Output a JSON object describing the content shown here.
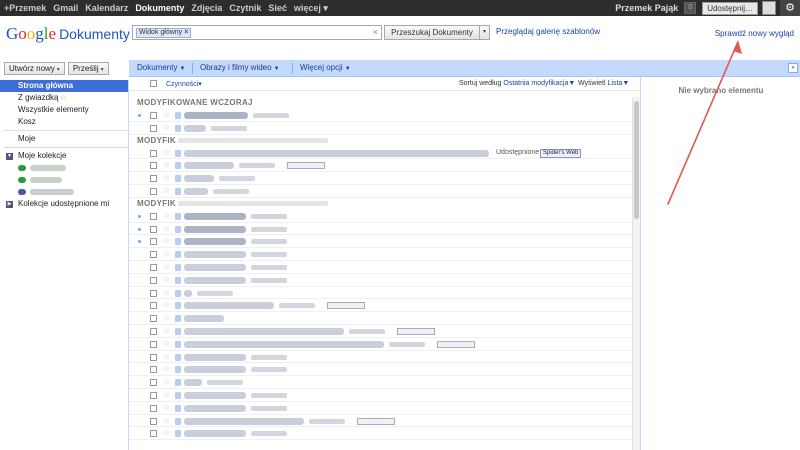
{
  "topbar": {
    "nav": [
      "+Przemek",
      "Gmail",
      "Kalendarz",
      "Dokumenty",
      "Zdjęcia",
      "Czytnik",
      "Sieć",
      "więcej ▾"
    ],
    "active_index": 3,
    "user_name": "Przemek Pająk",
    "notif_count": "0",
    "share_label": "Udostępnij…",
    "gear_icon": "gear-icon"
  },
  "header": {
    "logo_google": [
      "G",
      "o",
      "o",
      "g",
      "l",
      "e"
    ],
    "logo_product": "Dokumenty",
    "search_chip": "Widok główny",
    "search_clear": "×",
    "search_button": "Przeszukaj Dokumenty",
    "search_dropdown": "▾",
    "gallery_link": "Przeglądaj galerię szablonów",
    "new_look_link": "Sprawdź nowy wygląd"
  },
  "left_tools": {
    "create_label": "Utwórz nowy",
    "upload_label": "Prześlij"
  },
  "toolbar": {
    "documents": "Dokumenty",
    "images": "Obrazy i filmy wideo",
    "more": "Więcej opcji",
    "expand": "»"
  },
  "sidebar": {
    "home": "Strona główna",
    "starred": "Z gwiazdką",
    "all": "Wszystkie elementy",
    "trash": "Kosz",
    "mine": "Moje",
    "my_collections": "Moje kolekcje",
    "shared_collections": "Kolekcje udostępnione mi",
    "collection_colors": [
      "#2b9a3e",
      "#2b9a3e",
      "#4a56a8"
    ]
  },
  "main": {
    "actions_label": "Czynności",
    "sort_prefix": "Sortuj według",
    "sort_value": "Ostatnia modyfikacja",
    "view_prefix": "Wyświetl",
    "view_value": "Lista",
    "section_yesterday": "MODYFIKOWANE WCZORAJ",
    "section_week": "MODYFIK",
    "section_month": "MODYFIK",
    "shared_label": "Udostępnione",
    "collection_tag": "Spider's Web"
  },
  "right_pane": {
    "empty_label": "Nie wybrano elementu"
  },
  "annotation_color": "#e05a4e"
}
